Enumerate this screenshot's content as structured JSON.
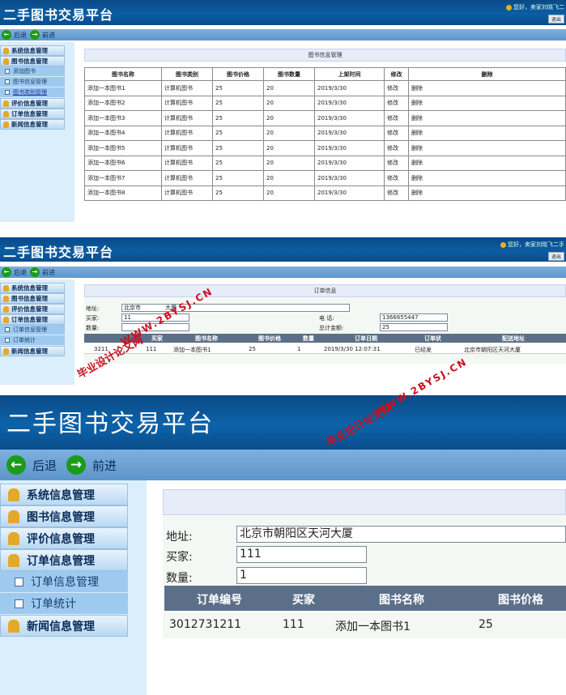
{
  "app": {
    "title": "二手图书交易平台",
    "welcome": "您好，卖家刘晓飞二",
    "welcome_short": "您好，卖家刘晓飞二手",
    "exit": "退出",
    "back": "后退",
    "forward": "前进"
  },
  "menu1": {
    "sys": "系统信息管理",
    "book": "图书信息管理",
    "sub_add": "添加图书",
    "sub_bookinfo": "图书信息管理",
    "sub_category": "图书类别管理",
    "review": "评价信息管理",
    "order": "订单信息管理",
    "news": "新闻信息管理"
  },
  "menu2": {
    "sys": "系统信息管理",
    "book": "图书信息管理",
    "review": "评价信息管理",
    "order": "订单信息管理",
    "sub_orderinfo": "订单信息管理",
    "sub_stats": "订单统计",
    "news": "新闻信息管理"
  },
  "books": {
    "heading": "图书信息管理",
    "cols": [
      "图书名称",
      "图书类别",
      "图书价格",
      "图书数量",
      "上架时间",
      "修改",
      "删除"
    ],
    "rows": [
      [
        "添加一本图书1",
        "计算机图书",
        "25",
        "20",
        "2019/3/30",
        "修改",
        "删除"
      ],
      [
        "添加一本图书2",
        "计算机图书",
        "25",
        "20",
        "2019/3/30",
        "修改",
        "删除"
      ],
      [
        "添加一本图书3",
        "计算机图书",
        "25",
        "20",
        "2019/3/30",
        "修改",
        "删除"
      ],
      [
        "添加一本图书4",
        "计算机图书",
        "25",
        "20",
        "2019/3/30",
        "修改",
        "删除"
      ],
      [
        "添加一本图书5",
        "计算机图书",
        "25",
        "20",
        "2019/3/30",
        "修改",
        "删除"
      ],
      [
        "添加一本图书6",
        "计算机图书",
        "25",
        "20",
        "2019/3/30",
        "修改",
        "删除"
      ],
      [
        "添加一本图书7",
        "计算机图书",
        "25",
        "20",
        "2019/3/30",
        "修改",
        "删除"
      ],
      [
        "添加一本图书8",
        "计算机图书",
        "25",
        "20",
        "2019/3/30",
        "修改",
        "删除"
      ]
    ]
  },
  "order": {
    "heading": "订单信息",
    "addr_label": "地址:",
    "addr_value": "北京市朝阳区天河大厦",
    "addr_value_obscured": "北京市",
    "addr_value_tail": "大厦",
    "buyer_label": "买家:",
    "buyer_value": "111",
    "buyer_value_obscured": "11",
    "phone_label": "电 话:",
    "phone_value": "1366655447",
    "qty_label": "数量:",
    "qty_value": "1",
    "total_label": "总计金额:",
    "total_value": "25",
    "cols": [
      "订单编号",
      "买家",
      "图书名称",
      "图书价格",
      "数量",
      "订单日期",
      "订单状态",
      "配送地址"
    ],
    "cols_visible": [
      "买家",
      "图书名称",
      "图书价格",
      "数量",
      "订单日期",
      "订单状",
      "配送地址"
    ],
    "row": {
      "id": "3012731211",
      "id_obscured": "3211",
      "buyer": "111",
      "book": "添加一本图书1",
      "price": "25",
      "qty": "1",
      "date": "2019/3/30 12:07:31",
      "status": "已经发",
      "addr": "北京市朝阳区天河大厦"
    }
  },
  "watermark": {
    "a": "毕业设计论文网",
    "b": "WWW.2BYSJ.CN"
  }
}
